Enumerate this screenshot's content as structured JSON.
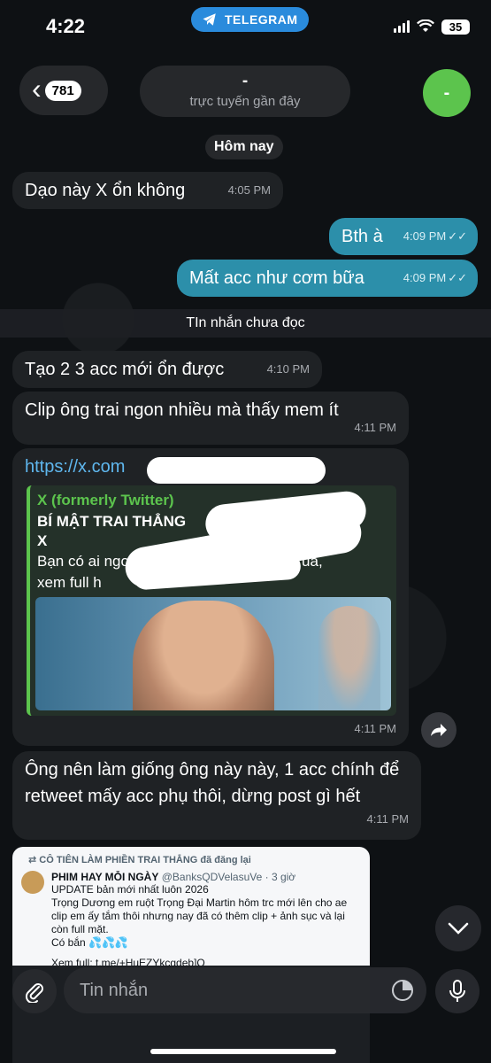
{
  "status_bar": {
    "time": "4:22",
    "app_pill": "TELEGRAM",
    "battery": "35"
  },
  "header": {
    "back_count": "781",
    "chat_name": "-",
    "chat_status": "trực tuyến gần đây",
    "avatar_initial": "-"
  },
  "date_separator": "Hôm nay",
  "unread_separator": "TIn nhắn chưa đọc",
  "messages": [
    {
      "text": "Dạo này X ổn không",
      "time": "4:05 PM"
    },
    {
      "text": "Bth à",
      "time": "4:09 PM"
    },
    {
      "text": "Mất acc như cơm bữa",
      "time": "4:09 PM"
    },
    {
      "text": "Tạo 2 3 acc mới ổn được",
      "time": "4:10 PM"
    },
    {
      "text": "Clip ông trai ngon nhiều mà thấy mem ít",
      "time": "4:11 PM"
    },
    {
      "text": "https://x.com",
      "time": "4:11 PM"
    },
    {
      "text": "Ông nên làm giống ông này này, 1 acc chính để retweet mấy acc phụ thôi, dừng post gì hết",
      "time": "4:11 PM"
    }
  ],
  "link_preview": {
    "site": "X (formerly Twitter)",
    "title_start": "BÍ MẬT TRAI THẲNG",
    "title_end_on": "on",
    "title_x": "X",
    "desc_start": "Bạn có ai ngon có thể tr",
    "desc_end": "ua,",
    "desc_line2": "xem full h"
  },
  "tweet": {
    "retweet_line": "CÔ TIÊN LÀM PHIỀN TRAI THẲNG đã đăng lại",
    "author": "PHIM HAY MỖI NGÀY",
    "handle": "@BanksQDVelasuVe · 3 giờ",
    "line1": "UPDATE bản mới nhất luôn 2026",
    "line2": "Trọng Dương em ruột Trọng Đại Martin hôm trc mới lên cho ae clip em ấy tắm thôi nhưng nay đã có thêm clip + ảnh sục và lại còn full mặt.",
    "line3": "Có bắn 💦💦💦",
    "line4": "Xem full: t.me/+HuEZYkcgdeb]Q"
  },
  "input": {
    "placeholder": "Tin nhắn"
  },
  "colors": {
    "outgoing_bubble": "#2c8faa",
    "incoming_bubble": "#1f2225",
    "link": "#5fb7ee",
    "preview_accent": "#5cc44d",
    "telegram_pill": "#2a8bdc",
    "avatar": "#5cc44d"
  }
}
